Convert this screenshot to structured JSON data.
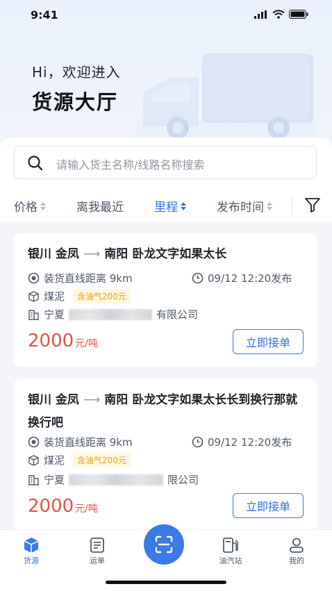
{
  "status_bar": {
    "time": "9:41"
  },
  "header": {
    "greeting": "Hi，欢迎进入",
    "title": "货源大厅"
  },
  "search": {
    "placeholder": "请输入货主名称/线路名称搜索"
  },
  "filters": [
    {
      "label": "价格",
      "active": false
    },
    {
      "label": "离我最近",
      "active": false
    },
    {
      "label": "里程",
      "active": true
    },
    {
      "label": "发布时间",
      "active": false
    }
  ],
  "cards": [
    {
      "origin": "银川 金凤",
      "destination": "南阳 卧龙文字如果太长",
      "distance": "装货直线距离 9km",
      "publish_time": "09/12 12:20发布",
      "cargo": "煤泥",
      "tag": "含油气200元",
      "company_prefix": "宁夏",
      "company_suffix": "有限公司",
      "price": "2000",
      "price_unit": "元/吨",
      "button": "立即接单"
    },
    {
      "origin": "银川 金凤",
      "destination": "南阳 卧龙文字如果太长长到换行那就换行吧",
      "distance": "装货直线距离 9km",
      "publish_time": "09/12 12:20发布",
      "cargo": "煤泥",
      "tag": "含油气200元",
      "company_prefix": "宁夏",
      "company_suffix": "限公司",
      "price": "2000",
      "price_unit": "元/吨",
      "button": "立即接单"
    }
  ],
  "tabbar": {
    "items": [
      {
        "label": "货源",
        "icon": "cube-icon",
        "active": true
      },
      {
        "label": "运单",
        "icon": "waybill-icon",
        "active": false
      },
      {
        "label": "",
        "icon": "scan-icon",
        "active": false
      },
      {
        "label": "油汽站",
        "icon": "gas-station-icon",
        "active": false
      },
      {
        "label": "我的",
        "icon": "user-icon",
        "active": false
      }
    ]
  },
  "colors": {
    "accent": "#2f6fe0",
    "price": "#e3534c",
    "tag_bg": "#fff7df",
    "tag_text": "#e0a020"
  }
}
